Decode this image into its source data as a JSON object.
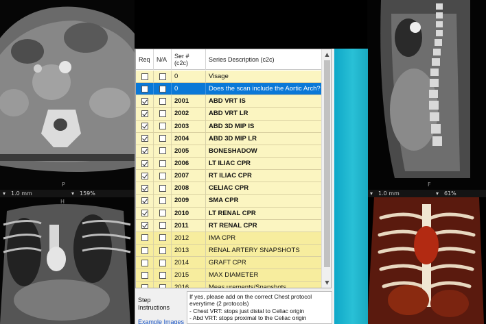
{
  "viewports": {
    "axial": {
      "bottom_label": "P",
      "slice": "1.0 mm",
      "zoom": "159%"
    },
    "sagittal": {
      "bottom_label": "F",
      "slice": "1.0 mm",
      "zoom": "61%"
    },
    "coronal": {
      "top_label": "H"
    }
  },
  "grid": {
    "headers": {
      "req": "Req",
      "na": "N/A",
      "ser": "Ser #\n(c2c)",
      "desc": "Series Description (c2c)"
    },
    "rows": [
      {
        "req": false,
        "na": false,
        "ser": "0",
        "desc": "Visage",
        "style": "yellow",
        "bold": false
      },
      {
        "req": false,
        "na": false,
        "ser": "0",
        "desc": "Does the scan include the Aortic Arch?",
        "style": "selected",
        "bold": false
      },
      {
        "req": true,
        "na": false,
        "ser": "2001",
        "desc": "ABD VRT IS",
        "style": "yellow",
        "bold": true
      },
      {
        "req": true,
        "na": false,
        "ser": "2002",
        "desc": "ABD VRT LR",
        "style": "yellow",
        "bold": true
      },
      {
        "req": true,
        "na": false,
        "ser": "2003",
        "desc": "ABD 3D MIP IS",
        "style": "yellow",
        "bold": true
      },
      {
        "req": true,
        "na": false,
        "ser": "2004",
        "desc": "ABD 3D MIP LR",
        "style": "yellow",
        "bold": true
      },
      {
        "req": true,
        "na": false,
        "ser": "2005",
        "desc": "BONESHADOW",
        "style": "yellow",
        "bold": true
      },
      {
        "req": true,
        "na": false,
        "ser": "2006",
        "desc": "LT ILIAC CPR",
        "style": "yellow",
        "bold": true
      },
      {
        "req": true,
        "na": false,
        "ser": "2007",
        "desc": "RT ILIAC CPR",
        "style": "yellow",
        "bold": true
      },
      {
        "req": true,
        "na": false,
        "ser": "2008",
        "desc": "CELIAC CPR",
        "style": "yellow",
        "bold": true
      },
      {
        "req": true,
        "na": false,
        "ser": "2009",
        "desc": "SMA CPR",
        "style": "yellow",
        "bold": true
      },
      {
        "req": true,
        "na": false,
        "ser": "2010",
        "desc": "LT RENAL CPR",
        "style": "yellow",
        "bold": true
      },
      {
        "req": true,
        "na": false,
        "ser": "2011",
        "desc": "RT RENAL CPR",
        "style": "yellow",
        "bold": true
      },
      {
        "req": false,
        "na": false,
        "ser": "2012",
        "desc": "IMA CPR",
        "style": "paleyellow",
        "bold": false
      },
      {
        "req": false,
        "na": false,
        "ser": "2013",
        "desc": "RENAL ARTERY SNAPSHOTS",
        "style": "paleyellow",
        "bold": false
      },
      {
        "req": false,
        "na": false,
        "ser": "2014",
        "desc": "GRAFT CPR",
        "style": "paleyellow",
        "bold": false
      },
      {
        "req": false,
        "na": false,
        "ser": "2015",
        "desc": "MAX DIAMETER",
        "style": "paleyellow",
        "bold": false
      },
      {
        "req": false,
        "na": false,
        "ser": "2016",
        "desc": "Meas urements/Snapshots",
        "style": "paleyellow",
        "bold": false
      }
    ]
  },
  "step_label": "Step\nInstructions",
  "example_link": "Example Images",
  "instructions": [
    "If yes, please add on the correct Chest protocol",
    "everytime (2 protocols)",
    "- Chest VRT: stops just distal to Celiac origin",
    "- Abd VRT: stops proximal to the Celiac origin"
  ]
}
